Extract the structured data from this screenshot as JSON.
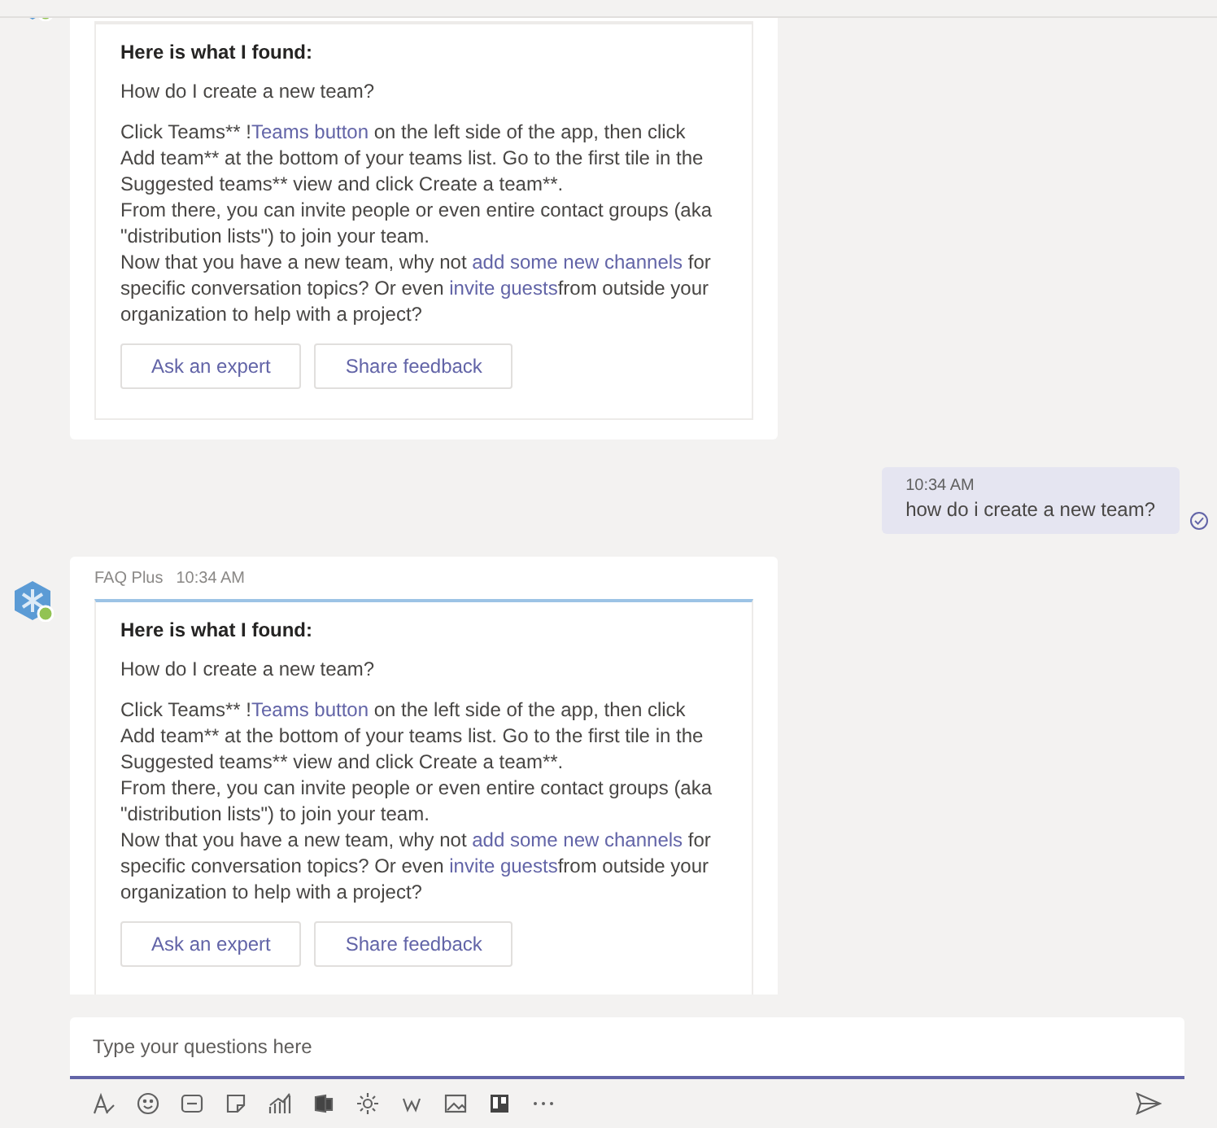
{
  "messages": [
    {
      "kind": "bot",
      "highlighted": false,
      "card": {
        "title": "Here is what I found:",
        "question": "How do I create a new team?",
        "paragraphs": [
          [
            {
              "text": "Click Teams** !",
              "link": false
            },
            {
              "text": "Teams button",
              "link": true
            },
            {
              "text": " on the left side of the app, then click Add team** at the bottom of your teams list. Go to the first tile in the Suggested teams** view and click Create a team**.",
              "link": false
            }
          ],
          [
            {
              "text": "From there, you can invite people or even entire contact groups (aka \"distribution lists\") to join your team.",
              "link": false
            }
          ],
          [
            {
              "text": "Now that you have a new team, why not ",
              "link": false
            },
            {
              "text": "add some new channels",
              "link": true
            },
            {
              "text": " for specific conversation topics? Or even ",
              "link": false
            },
            {
              "text": "invite guests",
              "link": true
            },
            {
              "text": "from outside your organization to help with a project?",
              "link": false
            }
          ]
        ],
        "buttons": [
          "Ask an expert",
          "Share feedback"
        ]
      }
    },
    {
      "kind": "user",
      "time": "10:34 AM",
      "text": "how do i create a new team?"
    },
    {
      "kind": "bot",
      "highlighted": true,
      "sender": "FAQ Plus",
      "time": "10:34 AM",
      "card": {
        "title": "Here is what I found:",
        "question": "How do I create a new team?",
        "paragraphs": [
          [
            {
              "text": "Click Teams** !",
              "link": false
            },
            {
              "text": "Teams button",
              "link": true
            },
            {
              "text": " on the left side of the app, then click Add team** at the bottom of your teams list. Go to the first tile in the Suggested teams** view and click Create a team**.",
              "link": false
            }
          ],
          [
            {
              "text": "From there, you can invite people or even entire contact groups (aka \"distribution lists\") to join your team.",
              "link": false
            }
          ],
          [
            {
              "text": "Now that you have a new team, why not ",
              "link": false
            },
            {
              "text": "add some new channels",
              "link": true
            },
            {
              "text": " for specific conversation topics? Or even ",
              "link": false
            },
            {
              "text": "invite guests",
              "link": true
            },
            {
              "text": "from outside your organization to help with a project?",
              "link": false
            }
          ]
        ],
        "buttons": [
          "Ask an expert",
          "Share feedback"
        ]
      }
    }
  ],
  "composer": {
    "placeholder": "Type your questions here"
  }
}
